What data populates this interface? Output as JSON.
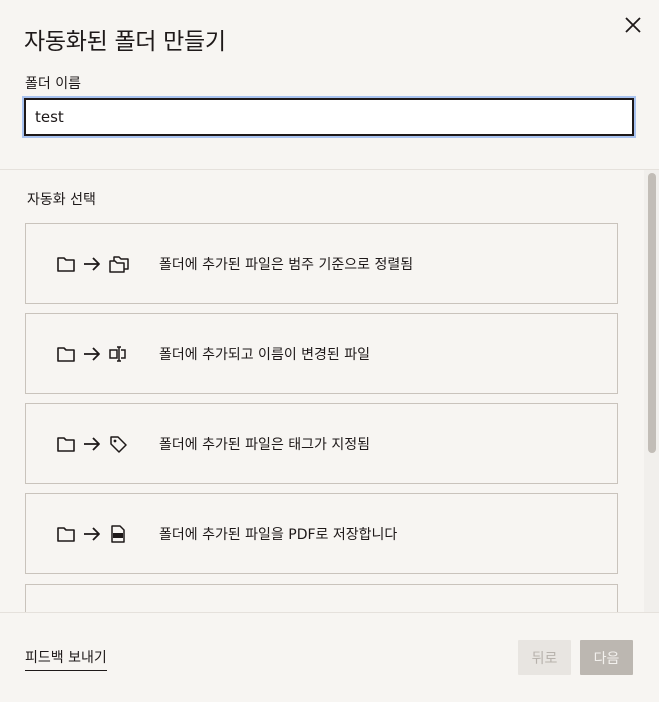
{
  "dialog": {
    "title": "자동화된 폴더 만들기",
    "close_icon": "close-icon"
  },
  "name_field": {
    "label": "폴더 이름",
    "value": "test"
  },
  "automation": {
    "section_label": "자동화 선택",
    "options": [
      {
        "label": "폴더에 추가된 파일은 범주 기준으로 정렬됨",
        "icons": [
          "folder-icon",
          "arrow-right-icon",
          "folders-icon"
        ]
      },
      {
        "label": "폴더에 추가되고 이름이 변경된 파일",
        "icons": [
          "folder-icon",
          "arrow-right-icon",
          "rename-icon"
        ]
      },
      {
        "label": "폴더에 추가된 파일은 태그가 지정됨",
        "icons": [
          "folder-icon",
          "arrow-right-icon",
          "tag-icon"
        ]
      },
      {
        "label": "폴더에 추가된 파일을 PDF로 저장합니다",
        "icons": [
          "folder-icon",
          "arrow-right-icon",
          "pdf-file-icon"
        ]
      },
      {
        "label": "",
        "icons": []
      }
    ]
  },
  "footer": {
    "feedback_label": "피드백 보내기",
    "back_label": "뒤로",
    "next_label": "다음"
  },
  "colors": {
    "background": "#f7f5f2",
    "text": "#1e1919",
    "input_focus_ring": "#a9c3f0",
    "disabled_button": "#bcb7b1"
  }
}
